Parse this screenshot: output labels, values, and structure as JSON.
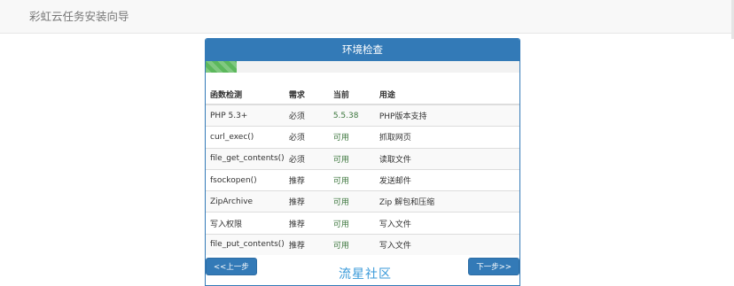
{
  "header": {
    "title": "彩虹云任务安装向导"
  },
  "panel": {
    "title": "环境检查",
    "progress": 0.1
  },
  "table": {
    "headers": [
      "函数检测",
      "需求",
      "当前",
      "用途"
    ],
    "rows": [
      [
        "PHP 5.3+",
        "必须",
        "5.5.38",
        "PHP版本支持"
      ],
      [
        "curl_exec()",
        "必须",
        "可用",
        "抓取网页"
      ],
      [
        "file_get_contents()",
        "必须",
        "可用",
        "读取文件"
      ],
      [
        "fsockopen()",
        "推荐",
        "可用",
        "发送邮件"
      ],
      [
        "ZipArchive",
        "推荐",
        "可用",
        "Zip 解包和压缩"
      ],
      [
        "写入权限",
        "推荐",
        "可用",
        "写入文件"
      ],
      [
        "file_put_contents()",
        "推荐",
        "可用",
        "写入文件"
      ]
    ]
  },
  "buttons": {
    "prev": "<<上一步",
    "next": "下一步>>"
  },
  "watermark": "流星社区",
  "colors": {
    "primary": "#337ab7",
    "success": "#3c763d",
    "progress": "#5cb85c"
  }
}
